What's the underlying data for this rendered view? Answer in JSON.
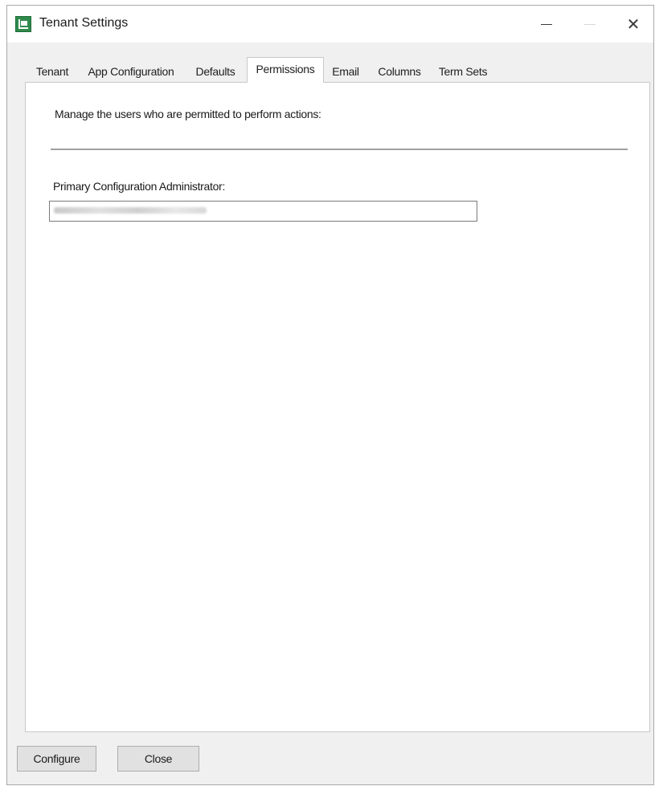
{
  "window": {
    "title": "Tenant Settings",
    "icon": "app-icon",
    "controls": {
      "minimize": "minimize-icon",
      "maximize": "maximize-icon",
      "close": "✕"
    }
  },
  "tabs": [
    {
      "label": "Tenant",
      "active": false
    },
    {
      "label": "App Configuration",
      "active": false
    },
    {
      "label": "Defaults",
      "active": false
    },
    {
      "label": "Permissions",
      "active": true
    },
    {
      "label": "Email",
      "active": false
    },
    {
      "label": "Columns",
      "active": false
    },
    {
      "label": "Term Sets",
      "active": false
    }
  ],
  "permissions": {
    "description": "Manage the users who are permitted to perform actions:",
    "primary_admin_label": "Primary Configuration Administrator:",
    "primary_admin_value": ""
  },
  "footer": {
    "configure_label": "Configure",
    "close_label": "Close"
  },
  "colors": {
    "window_bg": "#f0f0f0",
    "panel_bg": "#ffffff",
    "icon_green": "#2f8a4c"
  }
}
